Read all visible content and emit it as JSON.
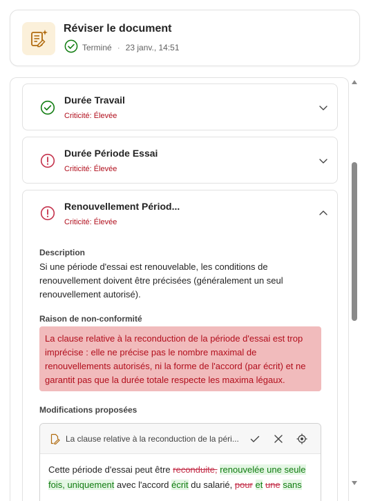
{
  "header": {
    "title": "Réviser le document",
    "status": "Terminé",
    "separator": "·",
    "timestamp": "23 janv., 14:51"
  },
  "items": [
    {
      "title": "Durée Travail",
      "criticality": "Criticité: Élevée",
      "status_icon": "check-circle-icon",
      "expanded": false
    },
    {
      "title": "Durée Période Essai",
      "criticality": "Criticité: Élevée",
      "status_icon": "error-circle-icon",
      "expanded": false
    },
    {
      "title": "Renouvellement Périod...",
      "criticality": "Criticité: Élevée",
      "status_icon": "error-circle-icon",
      "expanded": true
    }
  ],
  "expanded": {
    "description_label": "Description",
    "description_text": "Si une période d'essai est renouvelable, les conditions de renouvellement doivent être précisées (généralement un seul renouvellement autorisé).",
    "reason_label": "Raison de non-conformité",
    "reason_text": "La clause relative à la reconduction de la période d'essai est trop imprécise : elle ne précise pas le nombre maximal de renouvellements autorisés, ni la forme de l'accord (par écrit) et ne garantit pas que la durée totale respecte les maxima légaux.",
    "modifications_label": "Modifications proposées",
    "modification": {
      "title": "La clause relative à la reconduction de la péri...",
      "body": [
        {
          "t": "Cette période d'essai peut être ",
          "k": "plain"
        },
        {
          "t": "reconduite,",
          "k": "del"
        },
        {
          "t": " ",
          "k": "plain"
        },
        {
          "t": "renouvelée une seule fois, uniquement",
          "k": "ins"
        },
        {
          "t": " avec l'accord ",
          "k": "plain"
        },
        {
          "t": "écrit",
          "k": "ins"
        },
        {
          "t": " du salarié, ",
          "k": "plain"
        },
        {
          "t": "pour",
          "k": "del"
        },
        {
          "t": " ",
          "k": "plain"
        },
        {
          "t": "et",
          "k": "ins"
        },
        {
          "t": " ",
          "k": "plain"
        },
        {
          "t": "une",
          "k": "del"
        },
        {
          "t": " ",
          "k": "plain"
        },
        {
          "t": "sans",
          "k": "ins"
        }
      ]
    }
  },
  "colors": {
    "success": "#107c10",
    "danger": "#c4314b",
    "reason_bg": "#f1bbbc",
    "insert_bg": "#e4f6e4",
    "icon_bg": "#fbf0da"
  }
}
